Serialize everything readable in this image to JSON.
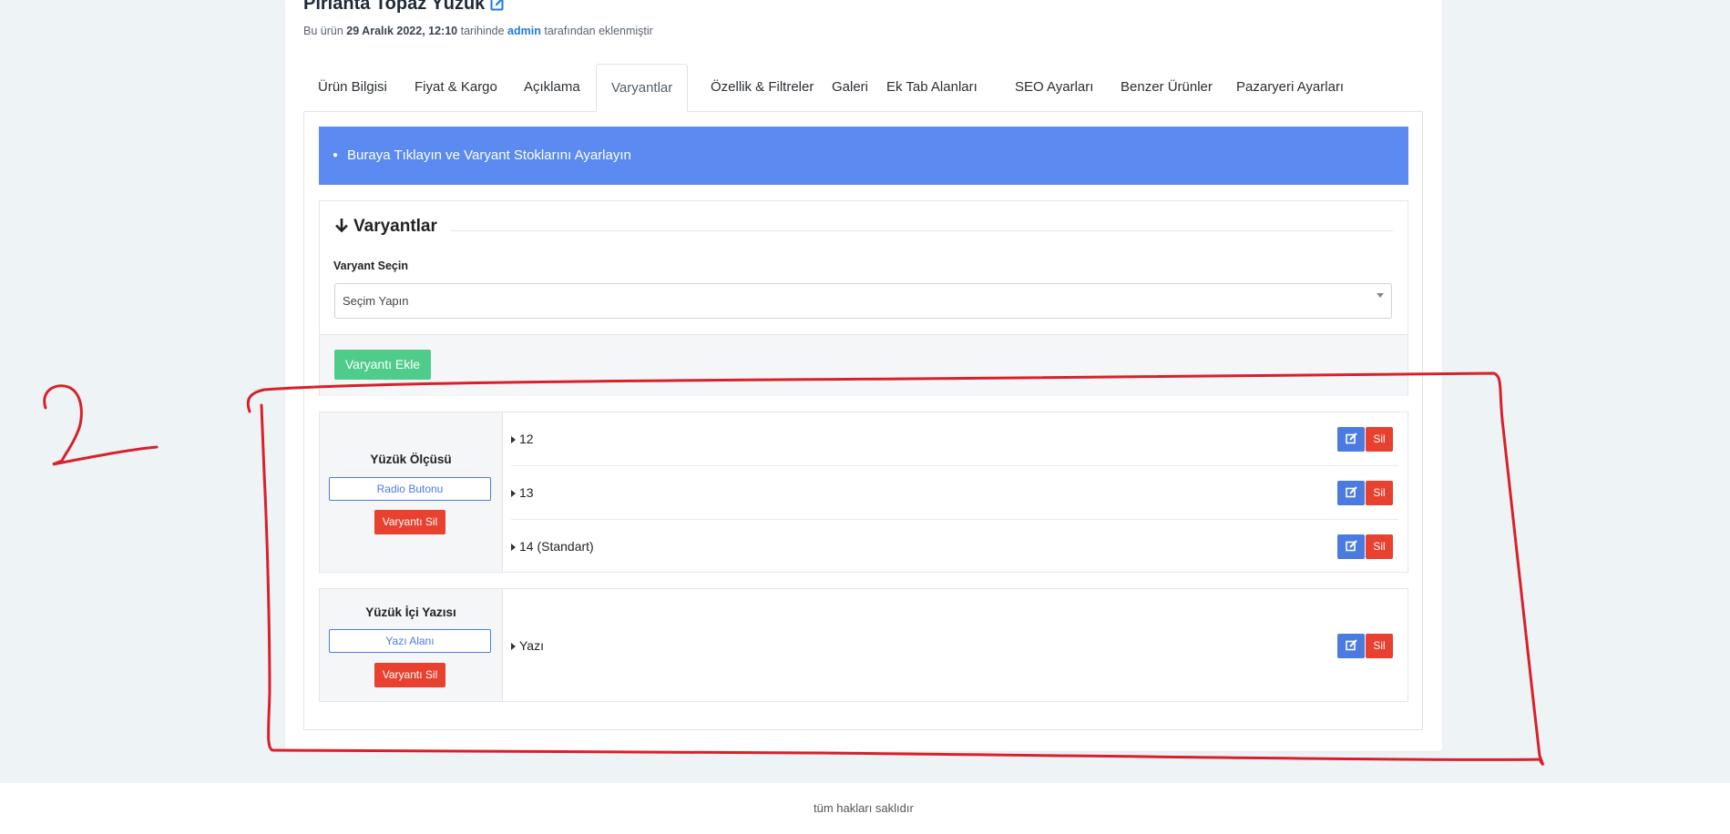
{
  "product": {
    "title": "Pırlanta Topaz Yüzük",
    "meta_prefix": "Bu ürün",
    "meta_date": "29 Aralık 2022, 12:10",
    "meta_mid": "tarihinde",
    "meta_author": "admin",
    "meta_suffix": "tarafından eklenmiştir"
  },
  "tabs": [
    {
      "label": "Ürün Bilgisi"
    },
    {
      "label": "Fiyat & Kargo"
    },
    {
      "label": "Açıklama"
    },
    {
      "label": "Varyantlar",
      "active": true
    },
    {
      "label": "Özellik & Filtreler"
    },
    {
      "label": "Galeri"
    },
    {
      "label": "Ek Tab Alanları"
    },
    {
      "label": "SEO Ayarları"
    },
    {
      "label": "Benzer Ürünler"
    },
    {
      "label": "Pazaryeri Ayarları"
    }
  ],
  "alert": {
    "text": "Buraya Tıklayın ve Varyant Stoklarını Ayarlayın"
  },
  "variants_panel": {
    "legend": "Varyantlar",
    "select_label": "Varyant Seçin",
    "select_value": "Seçim Yapın",
    "add_button": "Varyantı Ekle"
  },
  "groups": [
    {
      "name": "Yüzük Ölçüsü",
      "type": "Radio Butonu",
      "delete_label": "Varyantı Sil",
      "options": [
        {
          "label": "12",
          "delete": "Sil"
        },
        {
          "label": "13",
          "delete": "Sil"
        },
        {
          "label": "14 (Standart)",
          "delete": "Sil"
        }
      ]
    },
    {
      "name": "Yüzük İçi Yazısı",
      "type": "Yazı Alanı",
      "delete_label": "Varyantı Sil",
      "options": [
        {
          "label": "Yazı",
          "delete": "Sil"
        }
      ]
    }
  ],
  "footer": {
    "text": "tüm hakları saklıdır"
  },
  "colors": {
    "accent": "#5b8af0",
    "success": "#4fcc8a",
    "danger": "#e8412f",
    "primary": "#4b7be0",
    "annotation": "#d9202a"
  },
  "icons": {
    "title_edit": "edit-square-icon",
    "legend": "arrow-down-icon",
    "option_caret": "caret-right-icon",
    "edit_button": "edit-icon"
  }
}
